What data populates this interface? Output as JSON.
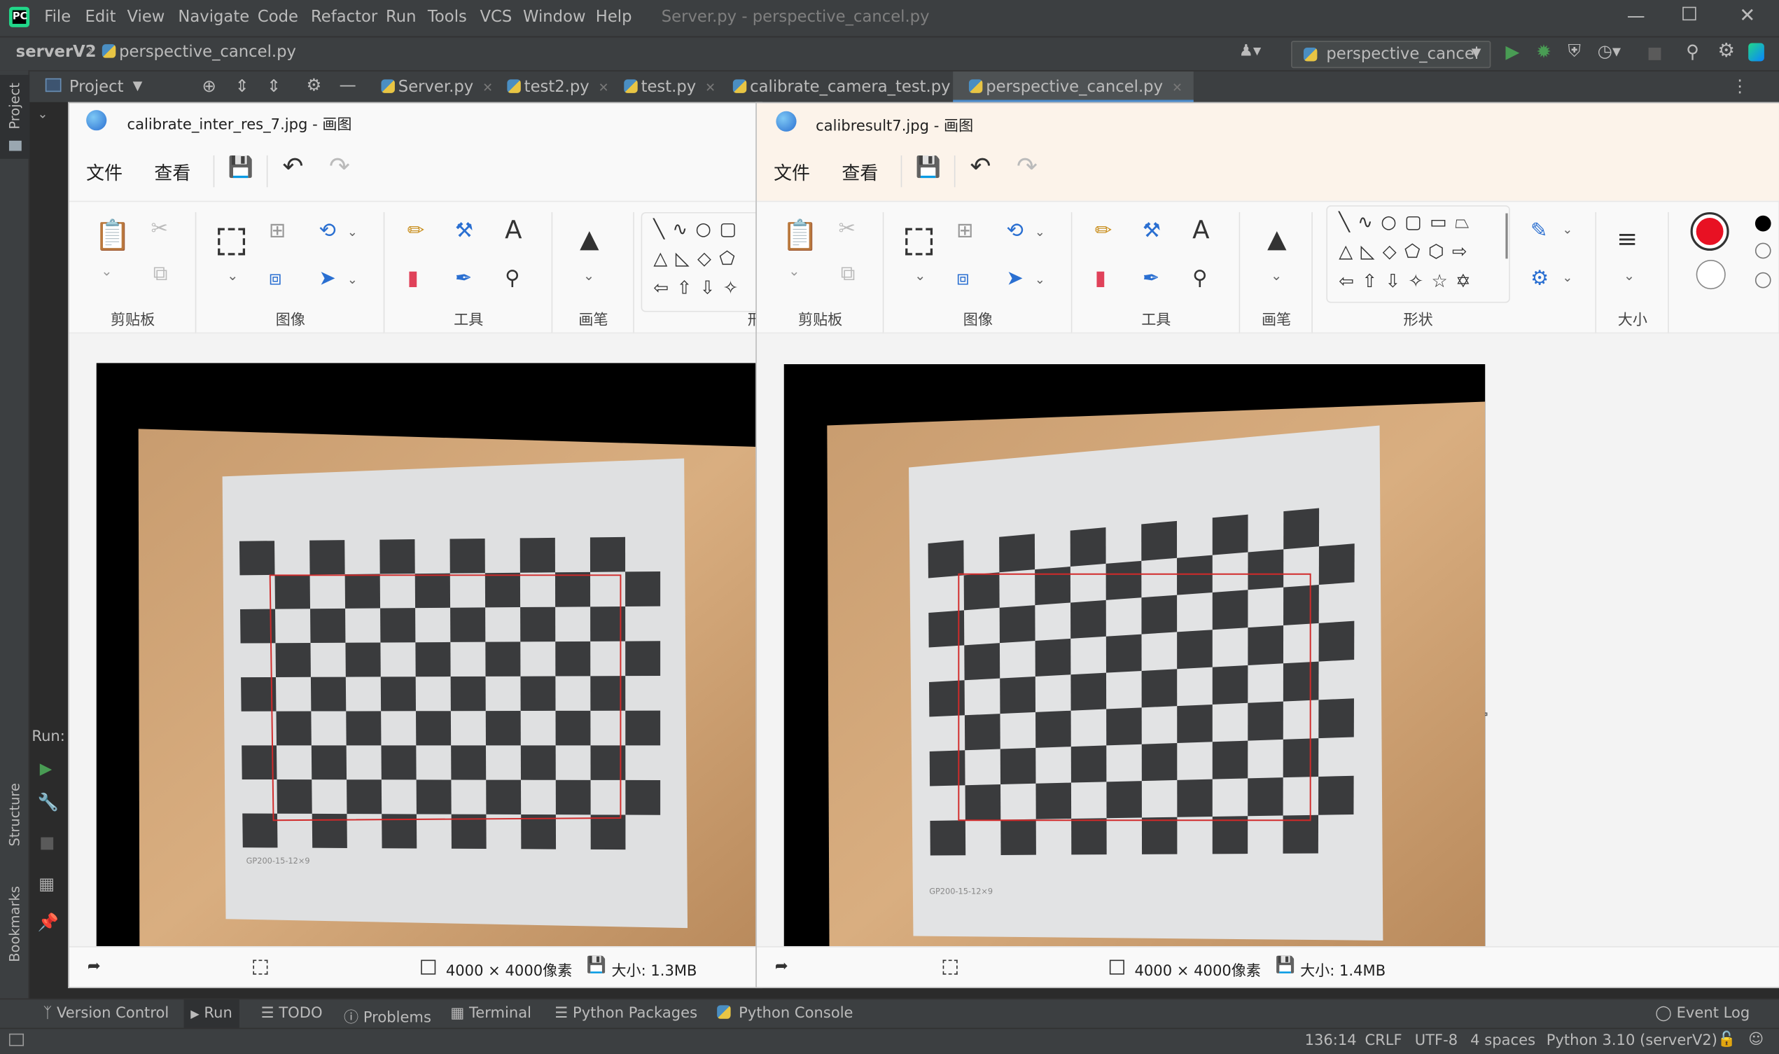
{
  "ide": {
    "menu": [
      "File",
      "Edit",
      "View",
      "Navigate",
      "Code",
      "Refactor",
      "Run",
      "Tools",
      "VCS",
      "Window",
      "Help"
    ],
    "window_title": "Server.py - perspective_cancel.py",
    "breadcrumb": {
      "project": "serverV2",
      "file": "perspective_cancel.py"
    },
    "run_config": "perspective_cancel",
    "project_tool": "Project",
    "tabs": [
      "Server.py",
      "test2.py",
      "test.py",
      "calibrate_camera_test.py",
      "perspective_cancel.py"
    ],
    "side_labels": {
      "project": "Project",
      "structure": "Structure",
      "bookmarks": "Bookmarks",
      "run": "Run:"
    },
    "bottom_tools": [
      "Version Control",
      "Run",
      "TODO",
      "Problems",
      "Terminal",
      "Python Packages",
      "Python Console"
    ],
    "event_log": "Event Log",
    "status": {
      "position": "136:14",
      "line_sep": "CRLF",
      "encoding": "UTF-8",
      "indent": "4 spaces",
      "interpreter": "Python 3.10 (serverV2)"
    }
  },
  "paint_left": {
    "title": "calibrate_inter_res_7.jpg - 画图",
    "menu": [
      "文件",
      "查看"
    ],
    "groups": [
      "剪贴板",
      "图像",
      "工具",
      "画笔",
      "形"
    ],
    "dimensions": "4000 × 4000像素",
    "size": "大小: 1.3MB"
  },
  "paint_right": {
    "title": "calibresult7.jpg - 画图",
    "menu": [
      "文件",
      "查看"
    ],
    "groups": [
      "剪贴板",
      "图像",
      "工具",
      "画笔",
      "形状",
      "大小"
    ],
    "dimensions": "4000 × 4000像素",
    "size": "大小: 1.4MB"
  },
  "photo_text": "GP200-15-12×9",
  "colors": {
    "ide_bg": "#2b2b2b",
    "ide_bar": "#3c3f41",
    "run_green": "#499c54",
    "paint_color1": "#e81123",
    "red_rect": "#d12a2a"
  }
}
